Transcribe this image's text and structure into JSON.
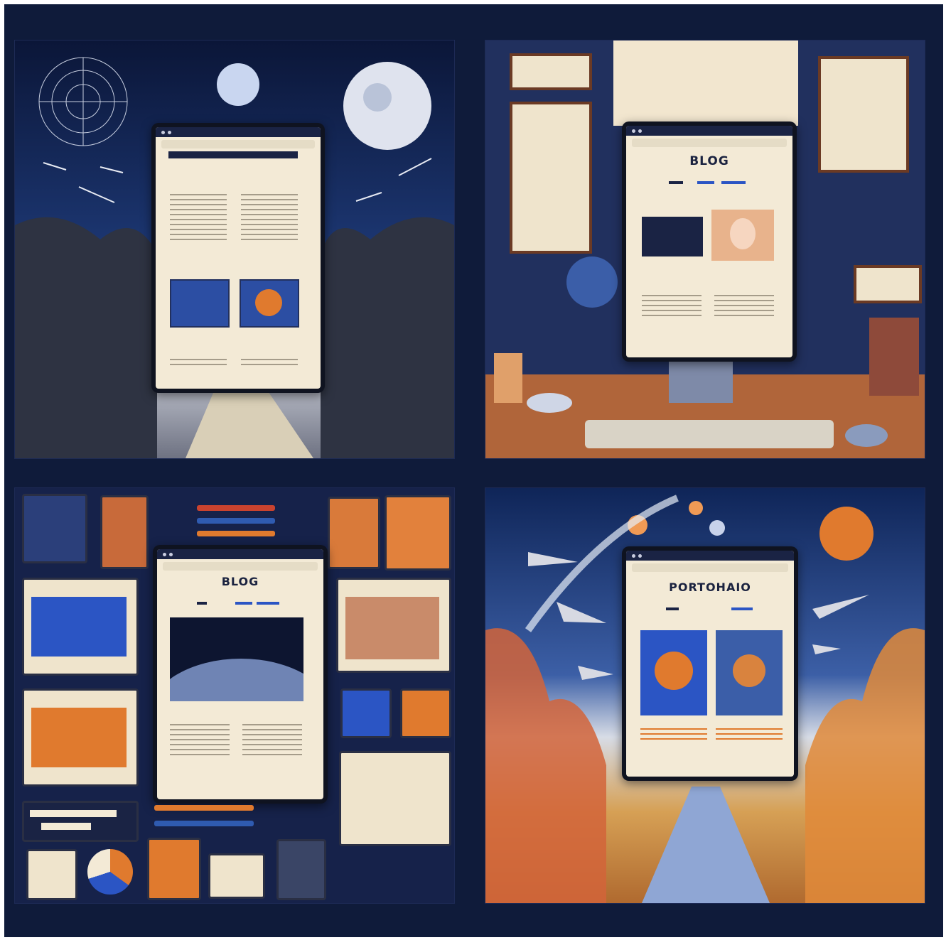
{
  "panels": [
    {
      "id": "top-left",
      "theme": "space-garden"
    },
    {
      "id": "top-right",
      "theme": "desk-workspace",
      "screen_title": "BLOG"
    },
    {
      "id": "bottom-left",
      "theme": "design-board",
      "screen_title": "BLOG"
    },
    {
      "id": "bottom-right",
      "theme": "sky-garden",
      "screen_title": "PORTOHAIO"
    }
  ],
  "colors": {
    "frame": "#0f1b3a",
    "screen": "#f3ead6",
    "accent_orange": "#e07a2e",
    "accent_blue": "#2b55c4",
    "dark_navy": "#1a2344"
  }
}
